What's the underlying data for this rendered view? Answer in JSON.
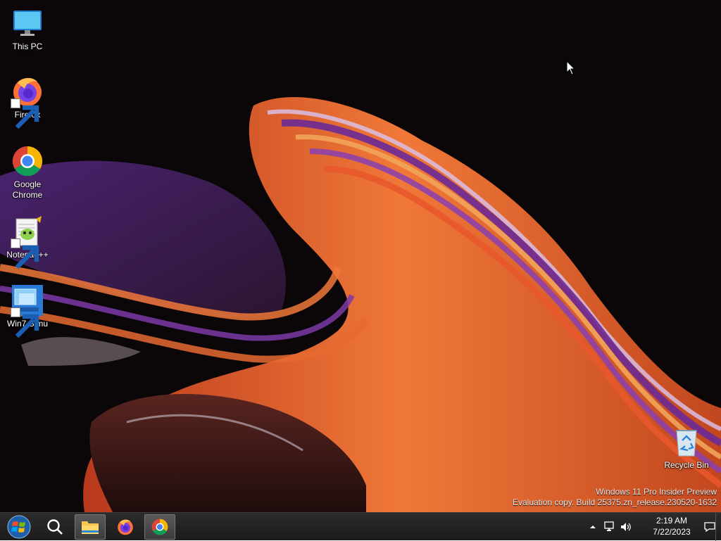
{
  "desktop": {
    "icons": [
      {
        "label": "This PC",
        "icon": "monitor-icon"
      },
      {
        "label": "Firefox",
        "icon": "firefox-icon"
      },
      {
        "label": "Google Chrome",
        "icon": "chrome-icon"
      },
      {
        "label": "Notepad++",
        "icon": "notepadpp-icon"
      },
      {
        "label": "Win7 Simu",
        "icon": "win7-simu-icon"
      },
      {
        "label": "Recycle Bin",
        "icon": "recycle-bin-icon"
      }
    ],
    "watermark": {
      "line1": "Windows 11 Pro Insider Preview",
      "line2": "Evaluation copy. Build 25375.zn_release.230520-1632"
    }
  },
  "taskbar": {
    "buttons": [
      {
        "name": "start",
        "icon": "windows-orb-icon"
      },
      {
        "name": "search",
        "icon": "search-icon"
      },
      {
        "name": "file-explorer",
        "icon": "folder-icon"
      },
      {
        "name": "firefox",
        "icon": "firefox-icon"
      },
      {
        "name": "chrome",
        "icon": "chrome-icon",
        "active": true
      }
    ],
    "tray": {
      "time": "2:19 AM",
      "date": "7/22/2023",
      "icons": [
        "chevron-up-icon",
        "network-icon",
        "volume-icon",
        "notification-icon"
      ]
    }
  },
  "colors": {
    "taskbar": "#1f1f1f",
    "background": "#0b0709",
    "wave_orange": "#e8582b",
    "wave_purple": "#6c2a8f"
  }
}
